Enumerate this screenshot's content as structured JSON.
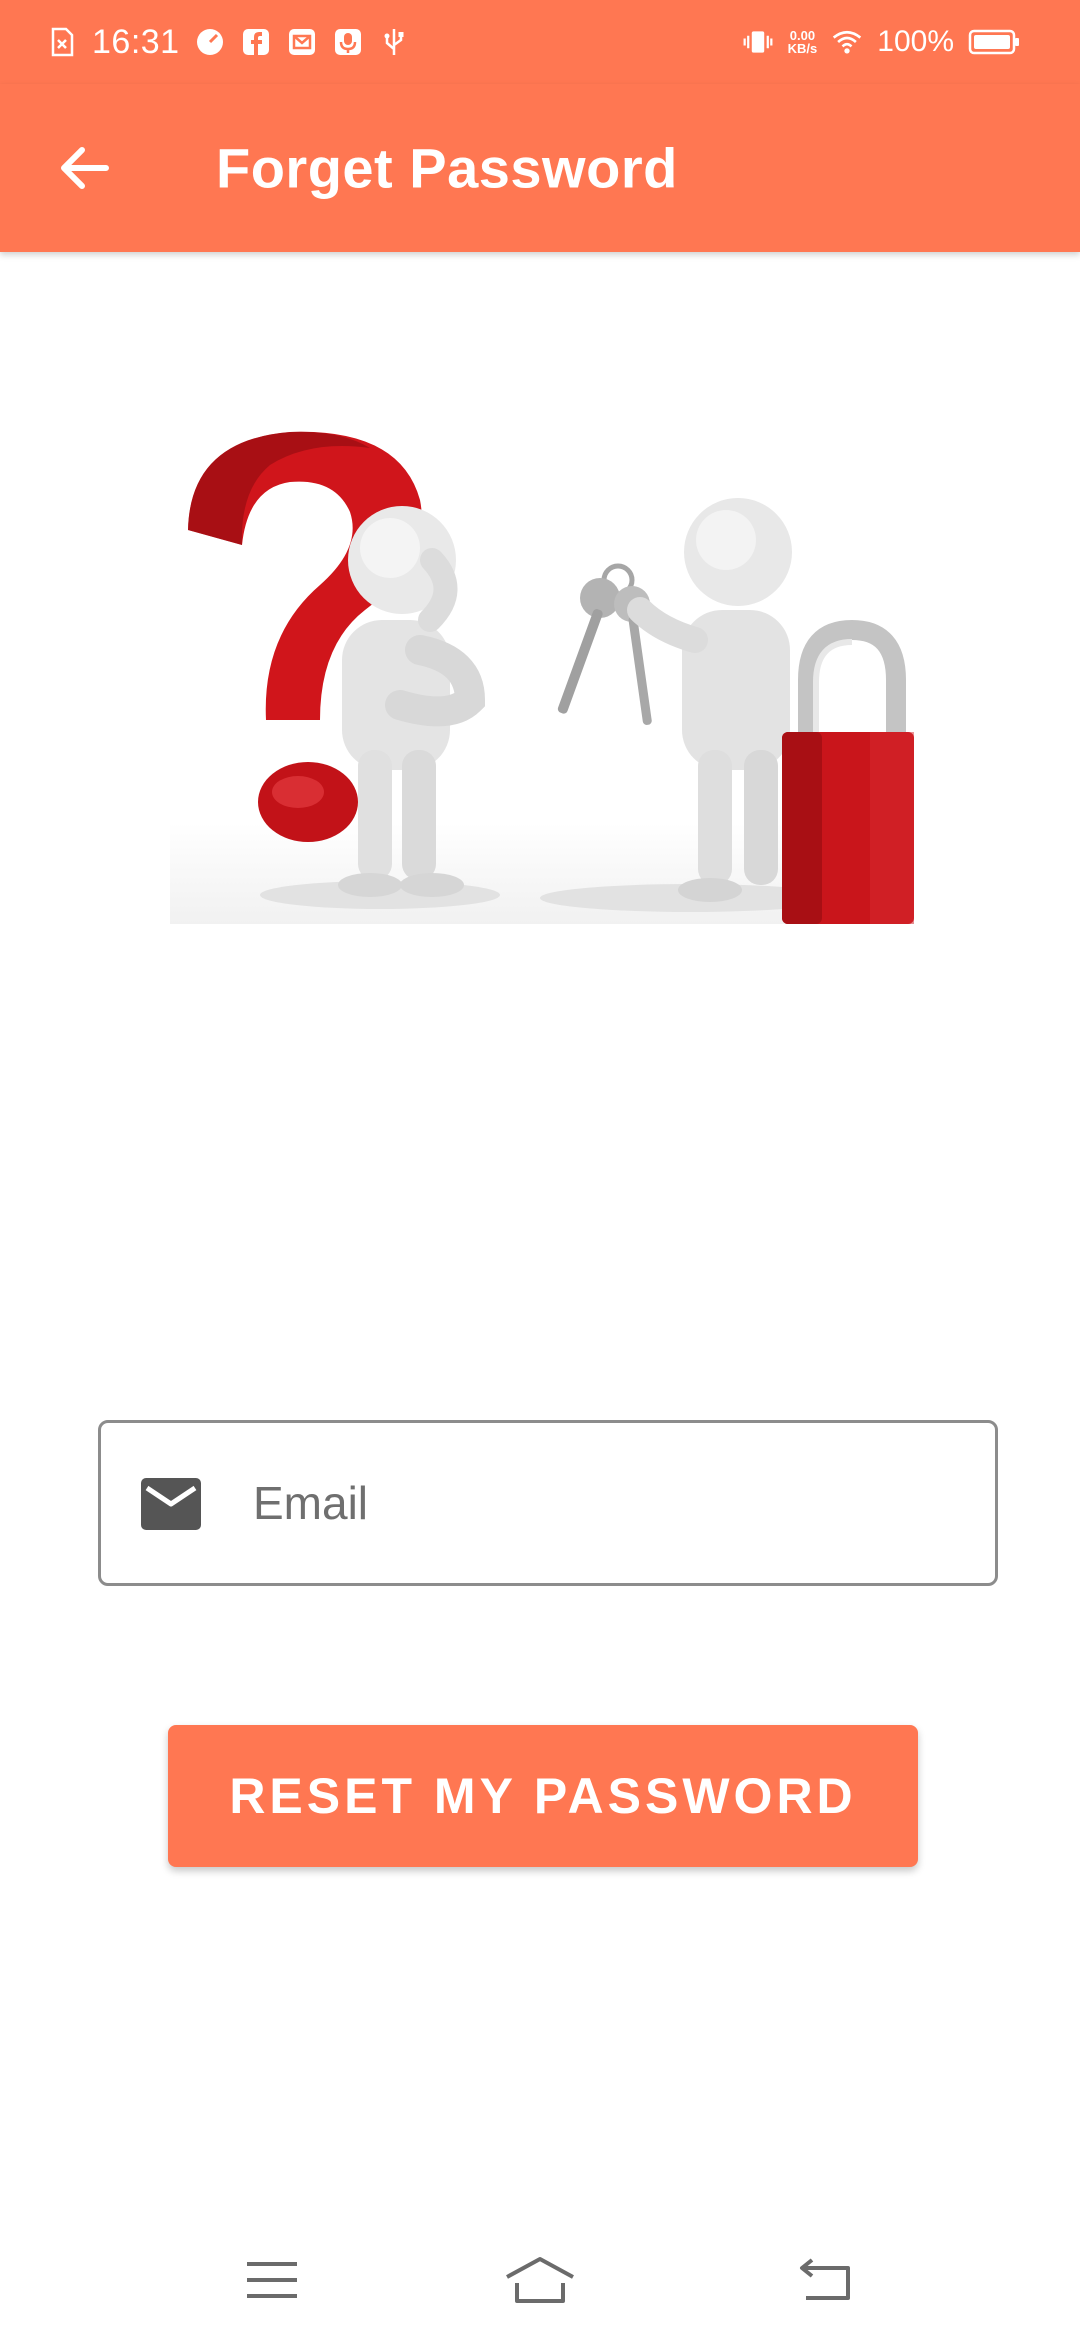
{
  "status_bar": {
    "time": "16:31",
    "net_speed_value": "0.00",
    "net_speed_unit": "KB/s",
    "battery": "100%"
  },
  "app_bar": {
    "title": "Forget Password",
    "back_icon": "arrow-back-icon"
  },
  "form": {
    "email_placeholder": "Email",
    "email_value": "",
    "email_icon": "mail-icon",
    "submit_label": "RESET MY PASSWORD"
  },
  "nav_bar": {
    "icons": [
      "menu-icon",
      "home-icon",
      "back-icon"
    ]
  },
  "colors": {
    "accent": "#ff7752",
    "illustration_red": "#d0151b",
    "field_border": "#8c8c8c"
  }
}
